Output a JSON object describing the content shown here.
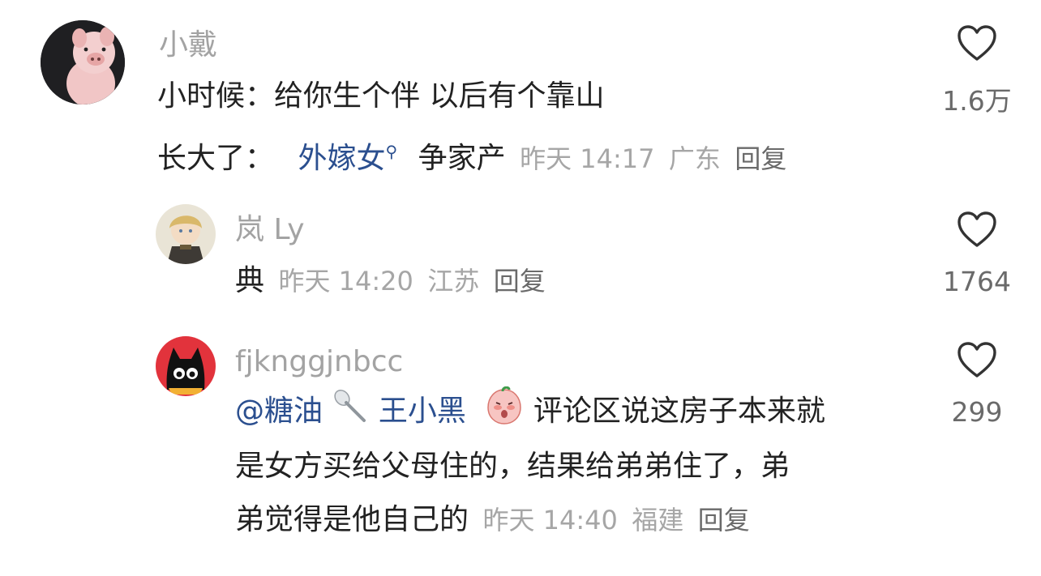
{
  "comments": [
    {
      "username": "小戴",
      "line1": "小时候：给你生个伴  以后有个靠山",
      "line2_prefix": "长大了：",
      "link": "外嫁女",
      "line2_suffix": "争家产",
      "time": "昨天 14:17",
      "location": "广东",
      "reply": "回复",
      "likes": "1.6万"
    },
    {
      "username": "岚 Ly",
      "text": "典",
      "time": "昨天 14:20",
      "location": "江苏",
      "reply": "回复",
      "likes": "1764"
    },
    {
      "username": "fjknggjnbcc",
      "mention": "@糖油",
      "mention2": "王小黑",
      "line1_rest": "评论区说这房子本来就",
      "line2": "是女方买给父母住的，结果给弟弟住了，弟",
      "line3": "弟觉得是他自己的",
      "time": "昨天 14:40",
      "location": "福建",
      "reply": "回复",
      "likes": "299"
    }
  ],
  "icons": [
    "heart-outline-icon",
    "search-superscript-icon",
    "spoon-emoji-icon",
    "blushing-face-emoji-icon"
  ],
  "colors": {
    "link": "#2b4f8f",
    "meta": "#a6a6a6",
    "text": "#222222"
  }
}
